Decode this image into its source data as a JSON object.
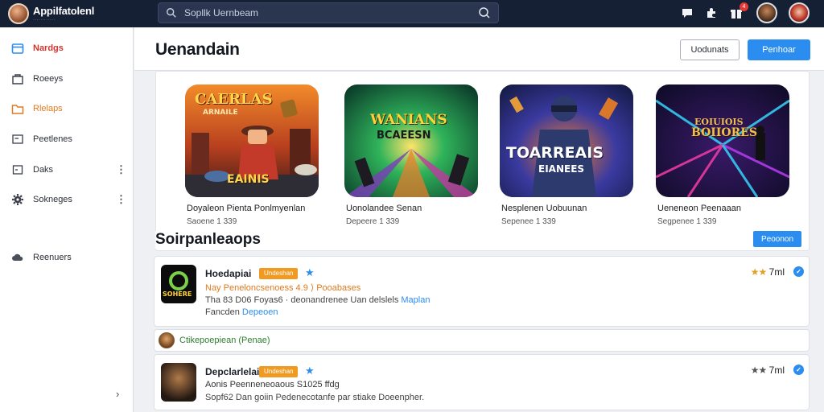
{
  "app": {
    "name": "Appilfatolenl",
    "tagline": "············",
    "accent": "#2b8df0",
    "topbar_bg": "#152035"
  },
  "search": {
    "placeholder": "Sopllk Uernbeam"
  },
  "topbar": {
    "icons": [
      "chat-icon",
      "puzzle-icon",
      "gift-icon",
      "user-avatar",
      "profile-avatar"
    ],
    "notification_count": "4"
  },
  "sidebar": {
    "items": [
      {
        "label": "Nardgs",
        "icon": "store-icon",
        "state": "active"
      },
      {
        "label": "Roeeys",
        "icon": "bag-icon"
      },
      {
        "label": "Rlelaps",
        "icon": "folder-icon",
        "state": "highlight"
      },
      {
        "label": "Peetlenes",
        "icon": "window-icon"
      },
      {
        "label": "Daks",
        "icon": "square-icon",
        "more": "⋮"
      },
      {
        "label": "Sokneges",
        "icon": "gear-icon",
        "more": "⋮"
      },
      {
        "label": "Reenuers",
        "icon": "cloud-icon"
      }
    ],
    "collapse": "›"
  },
  "header": {
    "title": "Uenandain",
    "outline_button": "Uodunats",
    "primary_button": "Penhoar"
  },
  "featured": [
    {
      "art_title": "CAERLAS",
      "art_sub": "ARNAILE",
      "art_badge": "EAINIS",
      "name": "Doyaleon Pienta Ponlmyenlan",
      "meta": "Saoene 1 339"
    },
    {
      "art_title": "WANIANS",
      "art_sub": "BCAEESN",
      "name": "Uonolandee Senan",
      "meta": "Depeere 1 339"
    },
    {
      "art_title": "TOARREAIS",
      "art_sub": "EIANEES",
      "name": "Nesplenen Uobuunan",
      "meta": "Sepenee 1 339"
    },
    {
      "art_title": "EOIUIOIS",
      "art_sub": "BOIIORES",
      "name": "Ueneneon Peenaaan",
      "meta": "Segpenee 1 339"
    }
  ],
  "section": {
    "title": "Soirpanleaops",
    "button": "Peoonon"
  },
  "list": [
    {
      "title": "Hoedapiai",
      "tag": "Undeshan",
      "line1": "Nay Peneloncsenoess 4.9 ⟩ Pooabases",
      "line2_a": "Tha 83 D06 Foyas6 · deonandrenee Uan delslels",
      "line2_b": "Maplan",
      "line3_a": "Fancden",
      "line3_b": "Depeoen",
      "stars": "★★",
      "rating": "7ml",
      "icon_text": "SOHERE"
    },
    {
      "title": "Depclarlelai",
      "tag": "Undeshan",
      "line1": "Aonis Peenneneoaous S1025 ffdg",
      "line2": "Sopf62 Dan goiin Pedenecotanfe par stiake Doeenpher.",
      "stars": "★★",
      "rating": "7ml"
    }
  ],
  "sub_row": {
    "label": "Ctikepoepiean (Penae)"
  }
}
